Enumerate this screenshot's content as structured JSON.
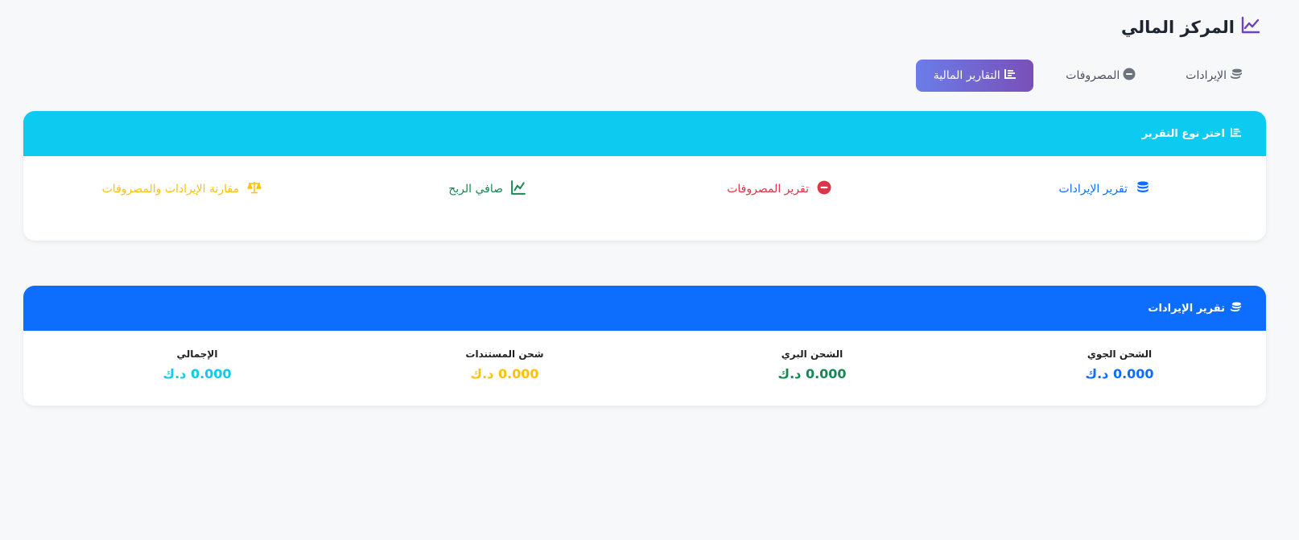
{
  "page": {
    "title": "المركز المالي"
  },
  "tabs": [
    {
      "label": "الإيرادات",
      "icon": "coins-icon"
    },
    {
      "label": "المصروفات",
      "icon": "minus-circle-icon"
    },
    {
      "label": "التقارير المالية",
      "icon": "report-list-icon",
      "active": true
    }
  ],
  "report_type": {
    "header": "اختر نوع التقرير",
    "options": [
      {
        "label": "تقرير الإيرادات",
        "icon": "coins-icon",
        "color": "#0d6efd"
      },
      {
        "label": "تقرير المصروفات",
        "icon": "minus-circle-icon",
        "color": "#dc3545"
      },
      {
        "label": "صافي الربح",
        "icon": "chart-line-icon",
        "color": "#198754"
      },
      {
        "label": "مقارنة الإيرادات والمصروفات",
        "icon": "balance-scale-icon",
        "color": "#ffc107"
      }
    ]
  },
  "revenue_report": {
    "header": "تقرير الإيرادات",
    "stats": [
      {
        "label": "الشحن الجوي",
        "value": "0.000 د.ك",
        "color": "#0d6efd"
      },
      {
        "label": "الشحن البري",
        "value": "0.000 د.ك",
        "color": "#198754"
      },
      {
        "label": "شحن المستندات",
        "value": "0.000 د.ك",
        "color": "#ffc107"
      },
      {
        "label": "الإجمالي",
        "value": "0.000 د.ك",
        "color": "#0dcaf0"
      }
    ]
  },
  "colors": {
    "accent_gradient_start": "#6b7de8",
    "accent_gradient_end": "#7a4fb8",
    "info": "#0dcaf0",
    "primary": "#0d6efd"
  }
}
